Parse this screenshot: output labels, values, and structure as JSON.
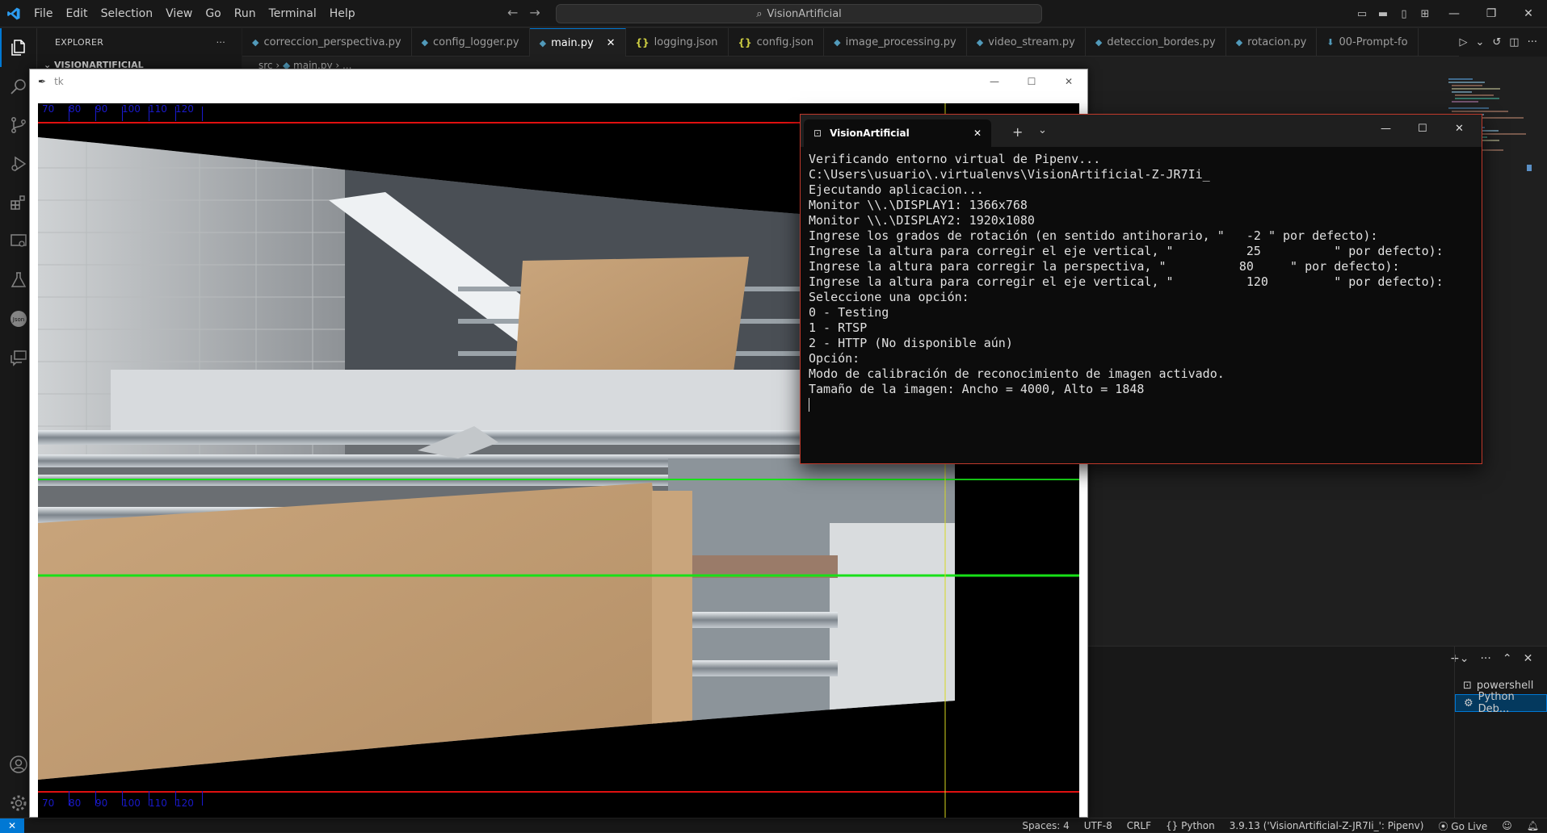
{
  "titlebar": {
    "menu": [
      "File",
      "Edit",
      "Selection",
      "View",
      "Go",
      "Run",
      "Terminal",
      "Help"
    ],
    "command_center": "VisionArtificial"
  },
  "sidebar": {
    "header": "EXPLORER",
    "more": "···",
    "root": "VISIONARTIFICIAL"
  },
  "tabs": [
    {
      "label": "correccion_perspectiva.py",
      "kind": "py",
      "active": false
    },
    {
      "label": "config_logger.py",
      "kind": "py",
      "active": false
    },
    {
      "label": "main.py",
      "kind": "py",
      "active": true
    },
    {
      "label": "logging.json",
      "kind": "json",
      "active": false
    },
    {
      "label": "config.json",
      "kind": "json",
      "active": false
    },
    {
      "label": "image_processing.py",
      "kind": "py",
      "active": false
    },
    {
      "label": "video_stream.py",
      "kind": "py",
      "active": false
    },
    {
      "label": "deteccion_bordes.py",
      "kind": "py",
      "active": false
    },
    {
      "label": "rotacion.py",
      "kind": "py",
      "active": false
    },
    {
      "label": "00-Prompt-fo",
      "kind": "dl",
      "active": false
    }
  ],
  "breadcrumb": {
    "folder": "src",
    "file": "main.py"
  },
  "tk_window": {
    "title": "tk",
    "ruler_labels": [
      "70",
      "80",
      "90",
      "100",
      "110",
      "120"
    ],
    "colors": {
      "red_line": "#e01010",
      "green_line": "#18e018",
      "yellow_line": "#d8d820",
      "ruler": "#1919c8"
    }
  },
  "terminal": {
    "tab_title": "VisionArtificial",
    "lines": [
      "Verificando entorno virtual de Pipenv...",
      "C:\\Users\\usuario\\.virtualenvs\\VisionArtificial-Z-JR7Ii_",
      "Ejecutando aplicacion...",
      "Monitor \\\\.\\DISPLAY1: 1366x768",
      "Monitor \\\\.\\DISPLAY2: 1920x1080",
      "Ingrese los grados de rotación (en sentido antihorario, \"   -2 \" por defecto):",
      "Ingrese la altura para corregir el eje vertical, \"          25          \" por defecto):",
      "Ingrese la altura para corregir la perspectiva, \"          80     \" por defecto):",
      "Ingrese la altura para corregir el eje vertical, \"          120         \" por defecto):",
      "Seleccione una opción:",
      "0 - Testing",
      "1 - RTSP",
      "2 - HTTP (No disponible aún)",
      "Opción:",
      "Modo de calibración de reconocimiento de imagen activado.",
      "Tamaño de la imagen: Ancho = 4000, Alto = 1848"
    ]
  },
  "panel": {
    "terminals": [
      {
        "label": "powershell",
        "selected": false
      },
      {
        "label": "Python Deb...",
        "selected": true
      }
    ]
  },
  "statusbar": {
    "spaces": "Spaces: 4",
    "encoding": "UTF-8",
    "eol": "CRLF",
    "language": "Python",
    "interpreter": "3.9.13 ('VisionArtificial-Z-JR7Ii_': Pipenv)",
    "golive": "Go Live"
  }
}
